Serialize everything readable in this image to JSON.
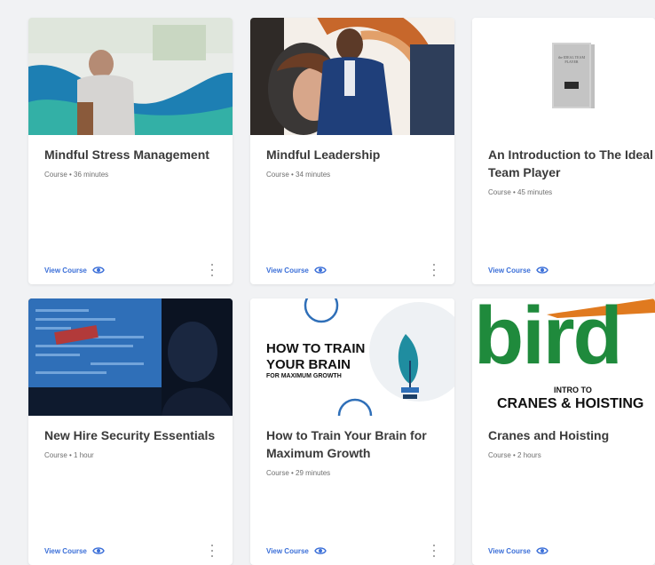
{
  "cards": [
    {
      "title": "Mindful Stress Management",
      "meta": "Course • 36 minutes",
      "action": "View Course"
    },
    {
      "title": "Mindful Leadership",
      "meta": "Course • 34 minutes",
      "action": "View Course"
    },
    {
      "title": "An Introduction to The Ideal Team Player",
      "meta": "Course • 45 minutes",
      "action": "View Course",
      "book_text": "the IDEAL TEAM PLAYER"
    },
    {
      "title": "New Hire Security Essentials",
      "meta": "Course • 1 hour",
      "action": "View Course"
    },
    {
      "title": "How to Train Your Brain for Maximum Growth",
      "meta": "Course • 29 minutes",
      "action": "View Course",
      "thumb_line1": "HOW TO TRAIN",
      "thumb_line2": "YOUR BRAIN",
      "thumb_line3": "FOR MAXIMUM GROWTH"
    },
    {
      "title": "Cranes and Hoisting",
      "meta": "Course • 2 hours",
      "action": "View Course",
      "thumb_logo": "bird",
      "thumb_sub1": "INTRO TO",
      "thumb_sub2": "CRANES & HOISTING"
    }
  ],
  "colors": {
    "accent": "#3b6fd8",
    "bird_green": "#1f8a3c",
    "bird_orange": "#e07a1f"
  },
  "icons": {
    "view": "eye-icon",
    "more": "more-vertical-icon"
  }
}
